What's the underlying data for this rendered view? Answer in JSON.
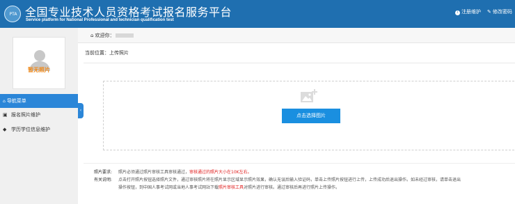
{
  "header": {
    "logo_text": "PTA",
    "title": "全国专业技术人员资格考试报名服务平台",
    "subtitle": "Service platform for National Professional and technician qualification test",
    "links": [
      {
        "icon": "info-icon",
        "label": "注册维护"
      },
      {
        "icon": "edit-icon",
        "label": "修改密码"
      }
    ]
  },
  "sidebar": {
    "photo_placeholder": "暂无照片",
    "nav_title": "导航菜单",
    "items": [
      {
        "icon": "image-icon",
        "label": "报名照片维护"
      },
      {
        "icon": "graduation-cap-icon",
        "label": "学历学位信息维护"
      }
    ]
  },
  "main": {
    "welcome_label": "欢迎你：",
    "location": "当前位置：上传照片",
    "upload_button": "点击选择图片",
    "notes": {
      "requirement_label": "照片要求:",
      "requirement_text_1": "照片必须通过照片审核工具审核通过，",
      "requirement_text_2": "审核通过的照片大小在10K左右。",
      "instruction_label": "有关说明:",
      "instruction_line1": "点击打开照片按钮选择照片文件，通过审核照片将在照片显示区域显示照片效果，确认无误后输入验证码，单击上传照片按钮进行上传，上传成功后退出操作。如未经过审核，请单击退出",
      "instruction_line2_a": "操作按钮，到中国人事考试网或当地人事考试网站下载",
      "instruction_line2_b": "照片审核工具",
      "instruction_line2_c": "对照片进行审核。通过审核后再进行照片上传操作。"
    }
  },
  "colors": {
    "header_bg": "#1f6fb0",
    "nav_active": "#2b86d8",
    "button": "#1a8fe0",
    "warning": "#e02020",
    "placeholder_text": "#f08a1b"
  }
}
